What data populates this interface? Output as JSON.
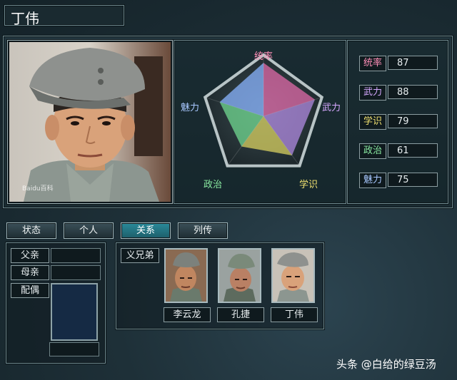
{
  "character": {
    "name": "丁伟"
  },
  "radar": {
    "axes": [
      "统率",
      "武力",
      "学识",
      "政治",
      "魅力"
    ],
    "colors": [
      "#e06aa8",
      "#b08ae0",
      "#d8d060",
      "#70d890",
      "#8ab4ff"
    ]
  },
  "chart_data": {
    "type": "radar",
    "axes": [
      "统率",
      "武力",
      "学识",
      "政治",
      "魅力"
    ],
    "values": [
      87,
      88,
      79,
      61,
      75
    ],
    "range": [
      0,
      100
    ]
  },
  "stats": [
    {
      "label": "统率",
      "value": "87",
      "color": "#ff8fb8"
    },
    {
      "label": "武力",
      "value": "88",
      "color": "#d6a8ff"
    },
    {
      "label": "学识",
      "value": "79",
      "color": "#f0e070"
    },
    {
      "label": "政治",
      "value": "61",
      "color": "#88e8a0"
    },
    {
      "label": "魅力",
      "value": "75",
      "color": "#a8c8ff"
    }
  ],
  "tabs": [
    {
      "label": "状态"
    },
    {
      "label": "个人"
    },
    {
      "label": "关系"
    },
    {
      "label": "列传"
    }
  ],
  "family": {
    "father_label": "父亲",
    "mother_label": "母亲",
    "spouse_label": "配偶"
  },
  "relations": {
    "type_label": "义兄弟",
    "members": [
      {
        "name": "李云龙"
      },
      {
        "name": "孔捷"
      },
      {
        "name": "丁伟"
      }
    ]
  },
  "photo_watermark": "Baidu百科",
  "watermark": "头条 @白给的绿豆汤"
}
